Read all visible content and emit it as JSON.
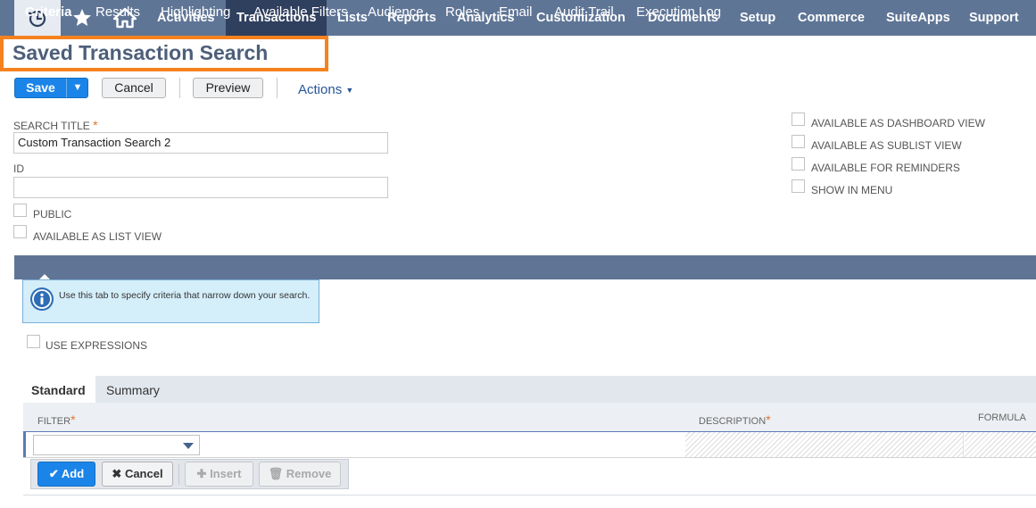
{
  "nav": {
    "icons": [
      "recent-records-icon",
      "star-icon",
      "home-icon"
    ],
    "items": [
      "Activities",
      "Transactions",
      "Lists",
      "Reports",
      "Analytics",
      "Customization",
      "Documents",
      "Setup",
      "Commerce",
      "SuiteApps",
      "Support"
    ],
    "active": "Transactions"
  },
  "page": {
    "title": "Saved Transaction Search"
  },
  "toolbar": {
    "save": "Save",
    "cancel": "Cancel",
    "preview": "Preview",
    "actions": "Actions"
  },
  "form": {
    "search_title_label": "SEARCH TITLE",
    "search_title_value": "Custom Transaction Search 2",
    "id_label": "ID",
    "id_value": "",
    "public_label": "PUBLIC",
    "list_view_label": "AVAILABLE AS LIST VIEW",
    "right_checkboxes": [
      "AVAILABLE AS DASHBOARD VIEW",
      "AVAILABLE AS SUBLIST VIEW",
      "AVAILABLE FOR REMINDERS",
      "SHOW IN MENU"
    ]
  },
  "tabs": [
    "Criteria",
    "Results",
    "Highlighting",
    "Available Filters",
    "Audience",
    "Roles",
    "Email",
    "Audit Trail",
    "Execution Log"
  ],
  "info": {
    "text": "Use this tab to specify criteria that narrow down your search."
  },
  "criteria": {
    "use_expressions_label": "USE EXPRESSIONS",
    "subtabs": [
      "Standard",
      "Summary"
    ],
    "columns": [
      "FILTER",
      "DESCRIPTION",
      "FORMULA"
    ],
    "buttons": {
      "add": "Add",
      "cancel": "Cancel",
      "insert": "Insert",
      "remove": "Remove"
    }
  },
  "colors": {
    "nav_bg": "#5f7596",
    "nav_active": "#2f3f5e",
    "accent_blue": "#1b84e8",
    "highlight": "#f5821f",
    "required": "#e2742d"
  }
}
